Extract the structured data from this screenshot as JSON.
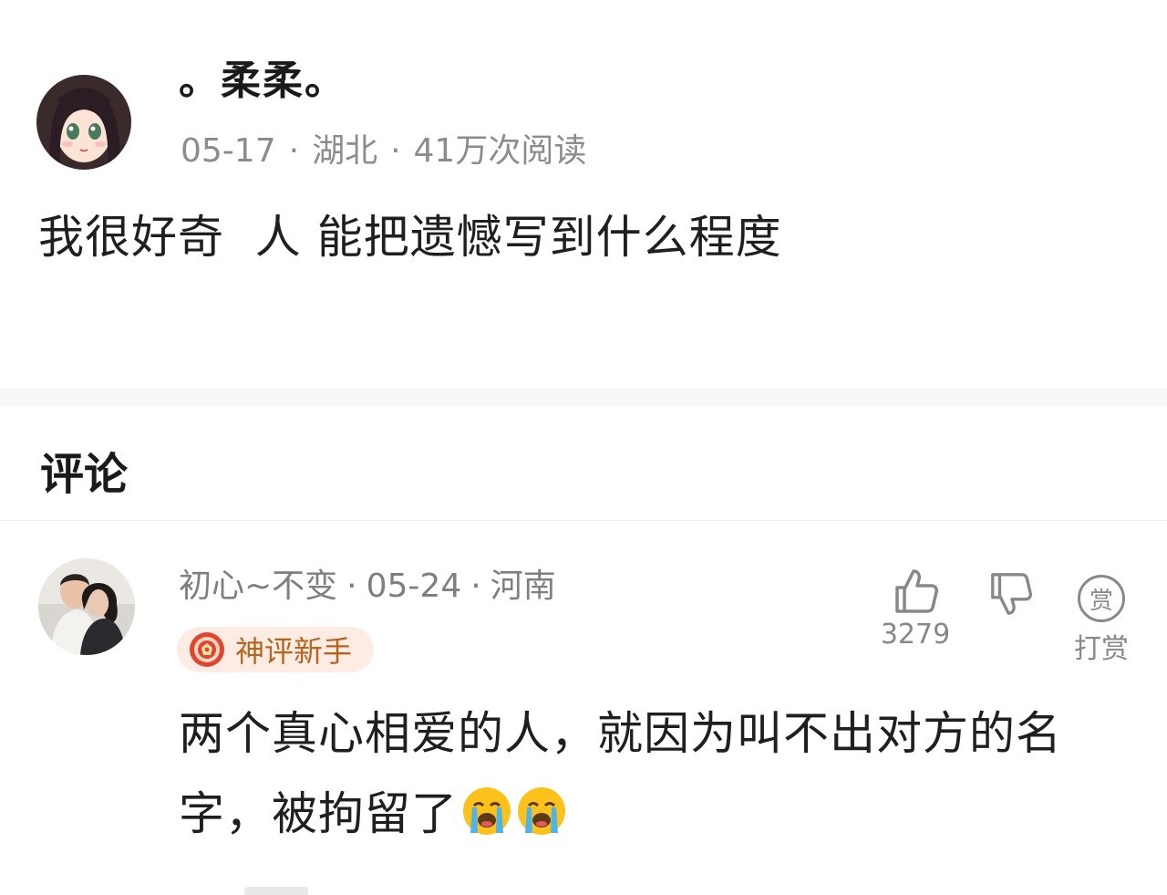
{
  "post": {
    "author": "。柔柔。",
    "date": "05-17",
    "location": "湖北",
    "reads": "41万次阅读",
    "content": "我很好奇  人 能把遗憾写到什么程度",
    "avatar_icon": "anime-girl-avatar"
  },
  "comments_section": {
    "heading": "评论"
  },
  "comment": {
    "author": "初心~不变",
    "date": "05-24",
    "location": "河南",
    "badge": "神评新手",
    "badge_icon": "medal-icon",
    "text": "两个真心相爱的人，就因为叫不出对方的名字，被拘留了",
    "emojis": [
      "loudly-crying-face",
      "loudly-crying-face"
    ],
    "like_count": "3279",
    "reward_glyph": "赏",
    "reward_label": "打赏",
    "avatar_icon": "couple-photo-avatar"
  },
  "meta_separator": "·",
  "colors": {
    "meta_gray": "#8c8c8c",
    "badge_bg": "#fdece3",
    "badge_text": "#b5651d",
    "badge_icon_red": "#e0452f"
  }
}
